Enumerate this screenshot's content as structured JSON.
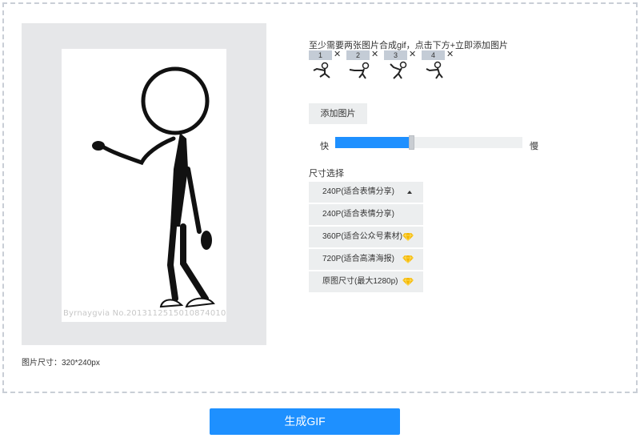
{
  "preview": {
    "watermark": "Byrnaygvia No.20131125150108740100",
    "size_text": "图片尺寸：320*240px"
  },
  "upload": {
    "hint": "至少需要两张图片合成gif，点击下方+立即添加图片",
    "close_glyph": "✕",
    "thumbnails": [
      {
        "index": "1"
      },
      {
        "index": "2"
      },
      {
        "index": "3"
      },
      {
        "index": "4"
      }
    ],
    "add_button": "添加图片"
  },
  "speed": {
    "fast_label": "快",
    "slow_label": "慢",
    "value_fraction": 0.4
  },
  "size_select": {
    "label": "尺寸选择",
    "selected": "240P(适合表情分享)",
    "options": [
      {
        "label": "240P(适合表情分享)",
        "premium": false
      },
      {
        "label": "360P(适合公众号素材)",
        "premium": true
      },
      {
        "label": "720P(适合高清海报)",
        "premium": true
      },
      {
        "label": "原图尺寸(最大1280p)",
        "premium": true
      }
    ]
  },
  "generate_button": "生成GIF",
  "colors": {
    "accent": "#1e90ff",
    "premium_gem": "#f5b800",
    "panel_border": "#c9ced6"
  }
}
